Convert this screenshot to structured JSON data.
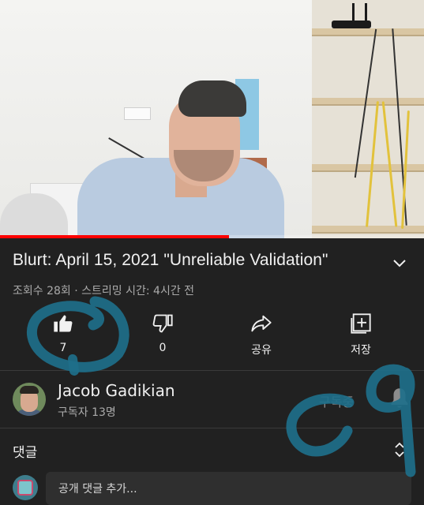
{
  "video": {
    "progress_fraction": 0.54,
    "progress_color": "#ff0000"
  },
  "title": "Blurt: April 15, 2021 \"Unreliable Validation\"",
  "meta": "조회수 28회 · 스트리밍 시간: 4시간 전",
  "actions": [
    {
      "icon": "thumbs-up-icon",
      "label": "7"
    },
    {
      "icon": "thumbs-down-icon",
      "label": "0"
    },
    {
      "icon": "share-icon",
      "label": "공유"
    },
    {
      "icon": "save-icon",
      "label": "저장"
    }
  ],
  "channel": {
    "name": "Jacob Gadikian",
    "subscribers": "구독자 13명",
    "subscribe_state": "구독중"
  },
  "comments": {
    "title": "댓글",
    "placeholder": "공개 댓글 추가..."
  },
  "annotation_color": "#1e6f8a"
}
